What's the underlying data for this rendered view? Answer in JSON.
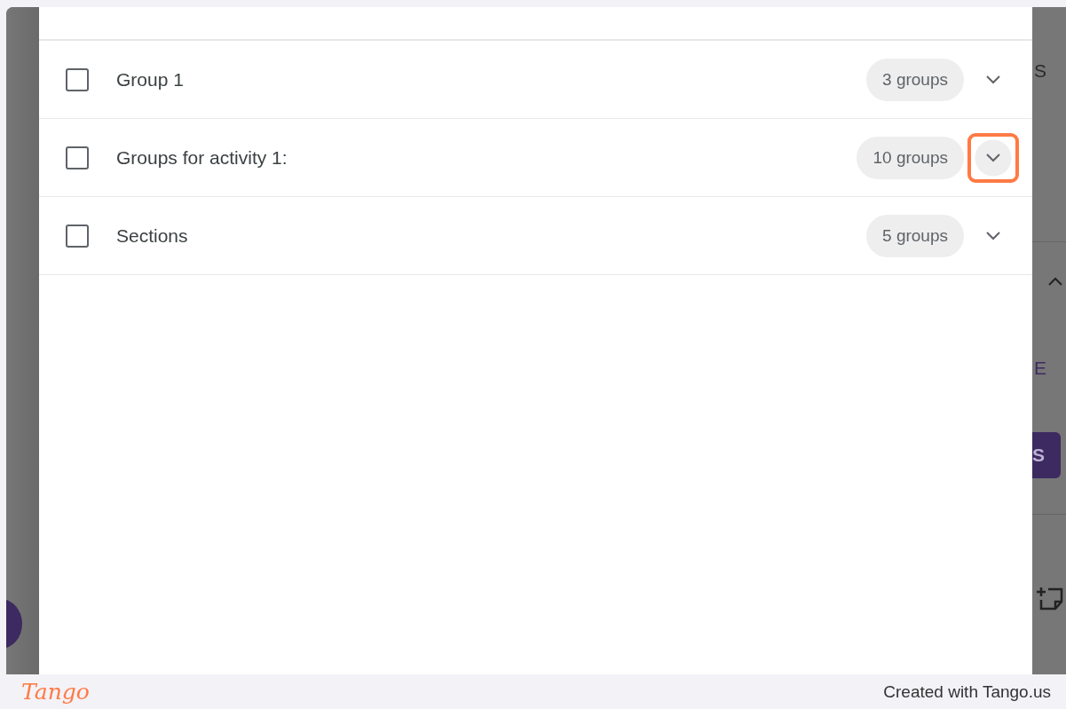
{
  "groups": [
    {
      "label": "Group 1",
      "count": "3 groups",
      "checked": false,
      "highlighted": false
    },
    {
      "label": "Groups for activity 1:",
      "count": "10 groups",
      "checked": false,
      "highlighted": true
    },
    {
      "label": "Sections",
      "count": "5 groups",
      "checked": false,
      "highlighted": false
    }
  ],
  "backdrop_texts": [
    "S",
    "E",
    "S"
  ],
  "footer": {
    "brand": "Tango",
    "credit": "Created with Tango.us"
  }
}
